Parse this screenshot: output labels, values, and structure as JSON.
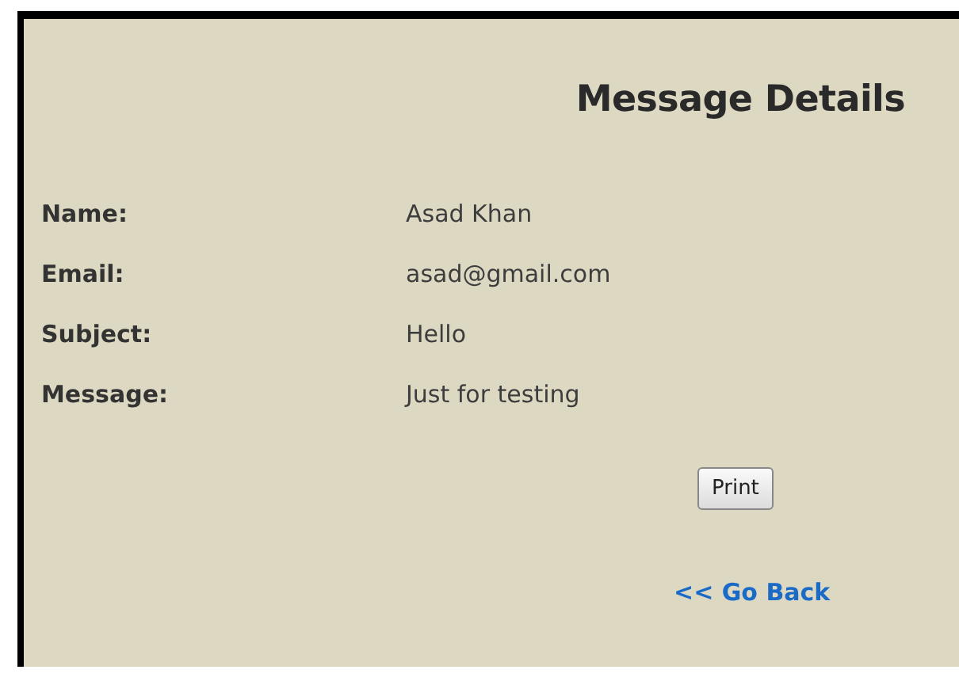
{
  "title": "Message Details",
  "fields": [
    {
      "label": "Name:",
      "value": "Asad Khan"
    },
    {
      "label": "Email:",
      "value": "asad@gmail.com"
    },
    {
      "label": "Subject:",
      "value": "Hello"
    },
    {
      "label": "Message:",
      "value": "Just for testing"
    }
  ],
  "print_button": "Print",
  "back_link": "<< Go Back"
}
